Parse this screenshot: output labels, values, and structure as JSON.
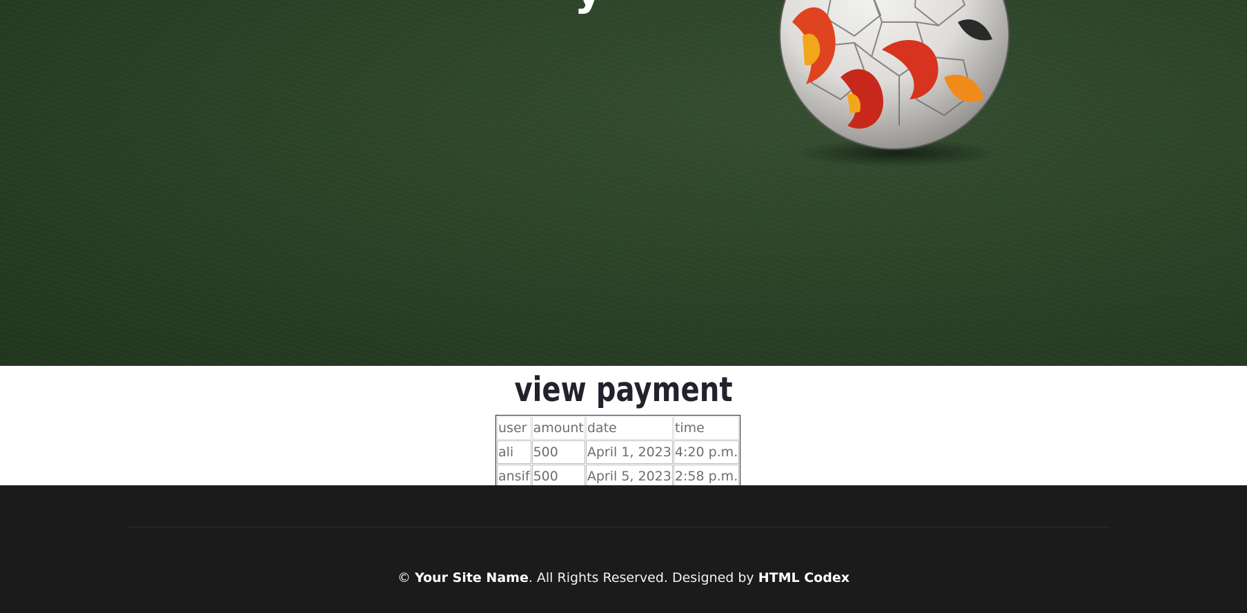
{
  "hero": {
    "title_fragment": "y",
    "ball_icon": "soccer-ball",
    "colors": {
      "grass": "#34502f",
      "ball_accent": "#e0431f"
    }
  },
  "content": {
    "title": "view payment",
    "table": {
      "headers": [
        "user",
        "amount",
        "date",
        "time"
      ],
      "rows": [
        [
          "ali",
          "500",
          "April 1, 2023",
          "4:20 p.m."
        ],
        [
          "ansif",
          "500",
          "April 5, 2023",
          "2:58 p.m."
        ]
      ]
    }
  },
  "footer": {
    "copyright_symbol": "©",
    "site_name": "Your Site Name",
    "rights_text": ". All Rights Reserved. Designed by",
    "designer": "HTML Codex",
    "colors": {
      "background": "#1b1b1b",
      "text": "#f3f3f3"
    }
  }
}
